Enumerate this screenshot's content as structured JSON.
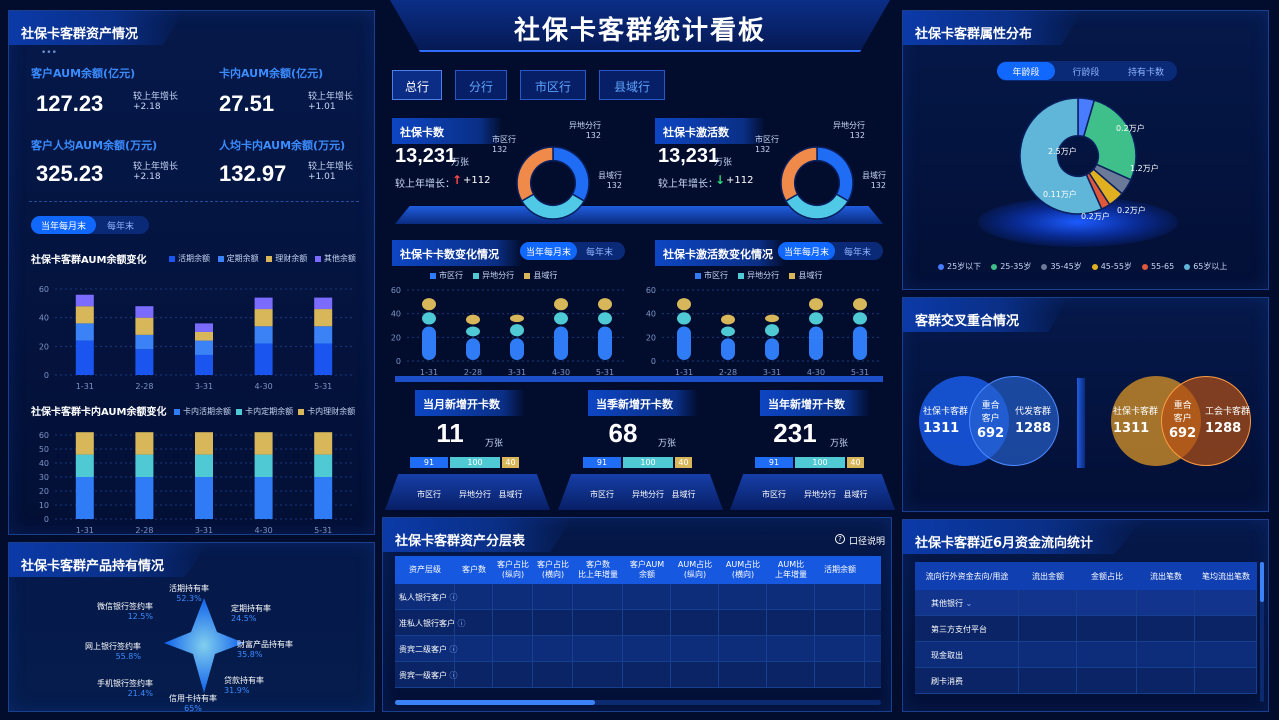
{
  "header": {
    "title": "社保卡客群统计看板"
  },
  "nav": {
    "tabs": [
      "总行",
      "分行",
      "市区行",
      "县域行"
    ],
    "active": 0
  },
  "assets": {
    "title": "社保卡客群资产情况",
    "metrics": [
      {
        "label": "客户AUM余额(亿元)",
        "value": "127.23",
        "cmp_label": "较上年增长",
        "cmp_value": "+2.18"
      },
      {
        "label": "卡内AUM余额(亿元)",
        "value": "27.51",
        "cmp_label": "较上年增长",
        "cmp_value": "+1.01"
      },
      {
        "label": "客户人均AUM余额(万元)",
        "value": "325.23",
        "cmp_label": "较上年增长",
        "cmp_value": "+2.18"
      },
      {
        "label": "人均卡内AUM余额(万元)",
        "value": "132.97",
        "cmp_label": "较上年增长",
        "cmp_value": "+1.01"
      }
    ],
    "toggle": [
      "当年每月末",
      "每年末"
    ],
    "chart1_title": "社保卡客群AUM余额变化",
    "chart2_title": "社保卡客群卡内AUM余额变化"
  },
  "product": {
    "title": "社保卡客群产品持有情况",
    "items": [
      {
        "name": "活期持有率",
        "value": "52.3%"
      },
      {
        "name": "定期持有率",
        "value": "24.5%"
      },
      {
        "name": "财富产品持有率",
        "value": "35.8%"
      },
      {
        "name": "贷款持有率",
        "value": "31.9%"
      },
      {
        "name": "信用卡持有率",
        "value": "65%"
      },
      {
        "name": "手机银行签约率",
        "value": "21.4%"
      },
      {
        "name": "网上银行签约率",
        "value": "55.8%"
      },
      {
        "name": "微信银行签约率",
        "value": "12.5%"
      }
    ]
  },
  "center": {
    "card_count": {
      "title": "社保卡数",
      "value": "13,231",
      "unit": "万张",
      "cmp_label": "较上年增长：",
      "cmp_value": "+112",
      "trend": "↑",
      "segments": [
        {
          "name": "市区行",
          "value": "132"
        },
        {
          "name": "异地分行",
          "value": "132"
        },
        {
          "name": "县域行",
          "value": "132"
        }
      ]
    },
    "active_count": {
      "title": "社保卡激活数",
      "value": "13,231",
      "unit": "万张",
      "cmp_label": "较上年增长：",
      "cmp_value": "+112",
      "trend": "↓",
      "segments": [
        {
          "name": "市区行",
          "value": "132"
        },
        {
          "name": "异地分行",
          "value": "132"
        },
        {
          "name": "县域行",
          "value": "132"
        }
      ]
    },
    "card_change": {
      "title": "社保卡卡数变化情况",
      "toggle": [
        "当年每月末",
        "每年末"
      ]
    },
    "active_change": {
      "title": "社保卡激活数变化情况",
      "toggle": [
        "当年每月末",
        "每年末"
      ]
    },
    "legend": [
      "市区行",
      "异地分行",
      "县域行"
    ],
    "new_cards": [
      {
        "title": "当月新增开卡数",
        "value": "11",
        "unit": "万张",
        "bars": [
          "91",
          "100",
          "40"
        ]
      },
      {
        "title": "当季新增开卡数",
        "value": "68",
        "unit": "万张",
        "bars": [
          "91",
          "100",
          "40"
        ]
      },
      {
        "title": "当年新增开卡数",
        "value": "231",
        "unit": "万张",
        "bars": [
          "91",
          "100",
          "40"
        ]
      }
    ],
    "new_legend": [
      "市区行",
      "异地分行",
      "县域行"
    ]
  },
  "tier": {
    "title": "社保卡客群资产分层表",
    "help": "口径说明",
    "headers": [
      "资产层级",
      "客户数",
      "客户占比\n(纵向)",
      "客户占比\n(横向)",
      "客户数\n比上年增量",
      "客户AUM\n余额",
      "AUM占比\n(纵向)",
      "AUM占比\n(横向)",
      "AUM比\n上年增量",
      "活期余额"
    ],
    "rows": [
      "私人银行客户",
      "准私人银行客户",
      "贵宾二级客户",
      "贵宾一级客户"
    ]
  },
  "attr": {
    "title": "社保卡客群属性分布",
    "tabs": [
      "年龄段",
      "行龄段",
      "持有卡数"
    ],
    "legend": [
      "25岁以下",
      "25-35岁",
      "35-45岁",
      "45-55岁",
      "55-65",
      "65岁以上"
    ],
    "labels": [
      "0.2万户",
      "1.2万户",
      "0.2万户",
      "0.2万户",
      "0.11万户",
      "2.5万户"
    ]
  },
  "overlap": {
    "title": "客群交叉重合情况",
    "left": {
      "a": "社保卡客群",
      "a_val": "1311",
      "mid": "重合\n客户",
      "mid_val": "692",
      "b": "代发客群",
      "b_val": "1288"
    },
    "right": {
      "a": "社保卡客群",
      "a_val": "1311",
      "mid": "重合\n客户",
      "mid_val": "692",
      "b": "工会卡客群",
      "b_val": "1288"
    }
  },
  "flow": {
    "title": "社保卡客群近6月资金流向统计",
    "headers": [
      "流向行外资金去向/用途",
      "流出金额",
      "金额占比",
      "流出笔数",
      "笔均流出笔数"
    ],
    "rows": [
      "其他银行",
      "第三方支付平台",
      "现金取出",
      "刷卡消费"
    ]
  },
  "colors": {
    "accent": "#1168ff",
    "cyan": "#4fd1d9",
    "gold": "#e0bb5a",
    "bg": "#020d2e"
  },
  "chart_data": [
    {
      "type": "bar",
      "title": "社保卡客群AUM余额变化",
      "categories": [
        "1-31",
        "2-28",
        "3-31",
        "4-30",
        "5-31"
      ],
      "ylim": [
        0,
        60
      ],
      "yticks": [
        "0",
        "20",
        "40",
        "60"
      ],
      "series": [
        {
          "name": "活期余额",
          "color": "#1a55f0",
          "values": [
            24,
            18,
            14,
            22,
            22
          ]
        },
        {
          "name": "定期余额",
          "color": "#3b82f6",
          "values": [
            12,
            10,
            10,
            12,
            12
          ]
        },
        {
          "name": "理财余额",
          "color": "#d8b75a",
          "values": [
            12,
            12,
            6,
            12,
            12
          ]
        },
        {
          "name": "其他余额",
          "color": "#7b6cff",
          "values": [
            8,
            8,
            6,
            8,
            8
          ]
        }
      ]
    },
    {
      "type": "bar",
      "title": "社保卡客群卡内AUM余额变化",
      "categories": [
        "1-31",
        "2-28",
        "3-31",
        "4-30",
        "5-31"
      ],
      "ylim": [
        0,
        60
      ],
      "yticks": [
        "0",
        "10",
        "20",
        "30",
        "40",
        "50",
        "60"
      ],
      "series": [
        {
          "name": "卡内活期余额",
          "color": "#2f7cf6",
          "values": [
            30,
            30,
            30,
            30,
            30
          ]
        },
        {
          "name": "卡内定期余额",
          "color": "#4fc9d4",
          "values": [
            16,
            16,
            16,
            16,
            16
          ]
        },
        {
          "name": "卡内理财余额",
          "color": "#d8b75a",
          "values": [
            16,
            16,
            16,
            16,
            16
          ]
        }
      ]
    },
    {
      "type": "bar",
      "title": "社保卡卡数变化情况",
      "categories": [
        "1-31",
        "2-28",
        "3-31",
        "4-30",
        "5-31"
      ],
      "ylim": [
        0,
        60
      ],
      "yticks": [
        "0",
        "20",
        "40",
        "60"
      ],
      "series": [
        {
          "name": "市区行",
          "color": "#2f7cf6",
          "values": [
            30,
            20,
            20,
            30,
            30
          ]
        },
        {
          "name": "异地分行",
          "color": "#4fc9d4",
          "values": [
            12,
            10,
            12,
            12,
            12
          ]
        },
        {
          "name": "县域行",
          "color": "#d8b75a",
          "values": [
            12,
            10,
            8,
            12,
            12
          ]
        }
      ]
    },
    {
      "type": "bar",
      "title": "社保卡激活数变化情况",
      "categories": [
        "1-31",
        "2-28",
        "3-31",
        "4-30",
        "5-31"
      ],
      "ylim": [
        0,
        60
      ],
      "yticks": [
        "0",
        "20",
        "40",
        "60"
      ],
      "series": [
        {
          "name": "市区行",
          "color": "#2f7cf6",
          "values": [
            30,
            20,
            20,
            30,
            30
          ]
        },
        {
          "name": "异地分行",
          "color": "#4fc9d4",
          "values": [
            12,
            10,
            12,
            12,
            12
          ]
        },
        {
          "name": "县域行",
          "color": "#d8b75a",
          "values": [
            12,
            10,
            8,
            12,
            12
          ]
        }
      ]
    },
    {
      "type": "pie",
      "title": "社保卡客群属性分布",
      "categories": [
        "25岁以下",
        "25-35岁",
        "35-45岁",
        "45-55岁",
        "55-65",
        "65岁以上"
      ],
      "values": [
        0.2,
        1.2,
        0.2,
        0.2,
        0.11,
        2.5
      ],
      "colors": [
        "#4a7cff",
        "#3fbf8a",
        "#6b7a99",
        "#e0b020",
        "#e0583a",
        "#5fb6d8"
      ]
    },
    {
      "type": "pie",
      "title": "社保卡数",
      "categories": [
        "市区行",
        "异地分行",
        "县域行"
      ],
      "values": [
        132,
        132,
        132
      ],
      "colors": [
        "#1f6cf5",
        "#4fc9e6",
        "#f08a4b"
      ]
    },
    {
      "type": "pie",
      "title": "社保卡激活数",
      "categories": [
        "市区行",
        "异地分行",
        "县域行"
      ],
      "values": [
        132,
        132,
        132
      ],
      "colors": [
        "#1f6cf5",
        "#4fc9e6",
        "#f08a4b"
      ]
    }
  ]
}
